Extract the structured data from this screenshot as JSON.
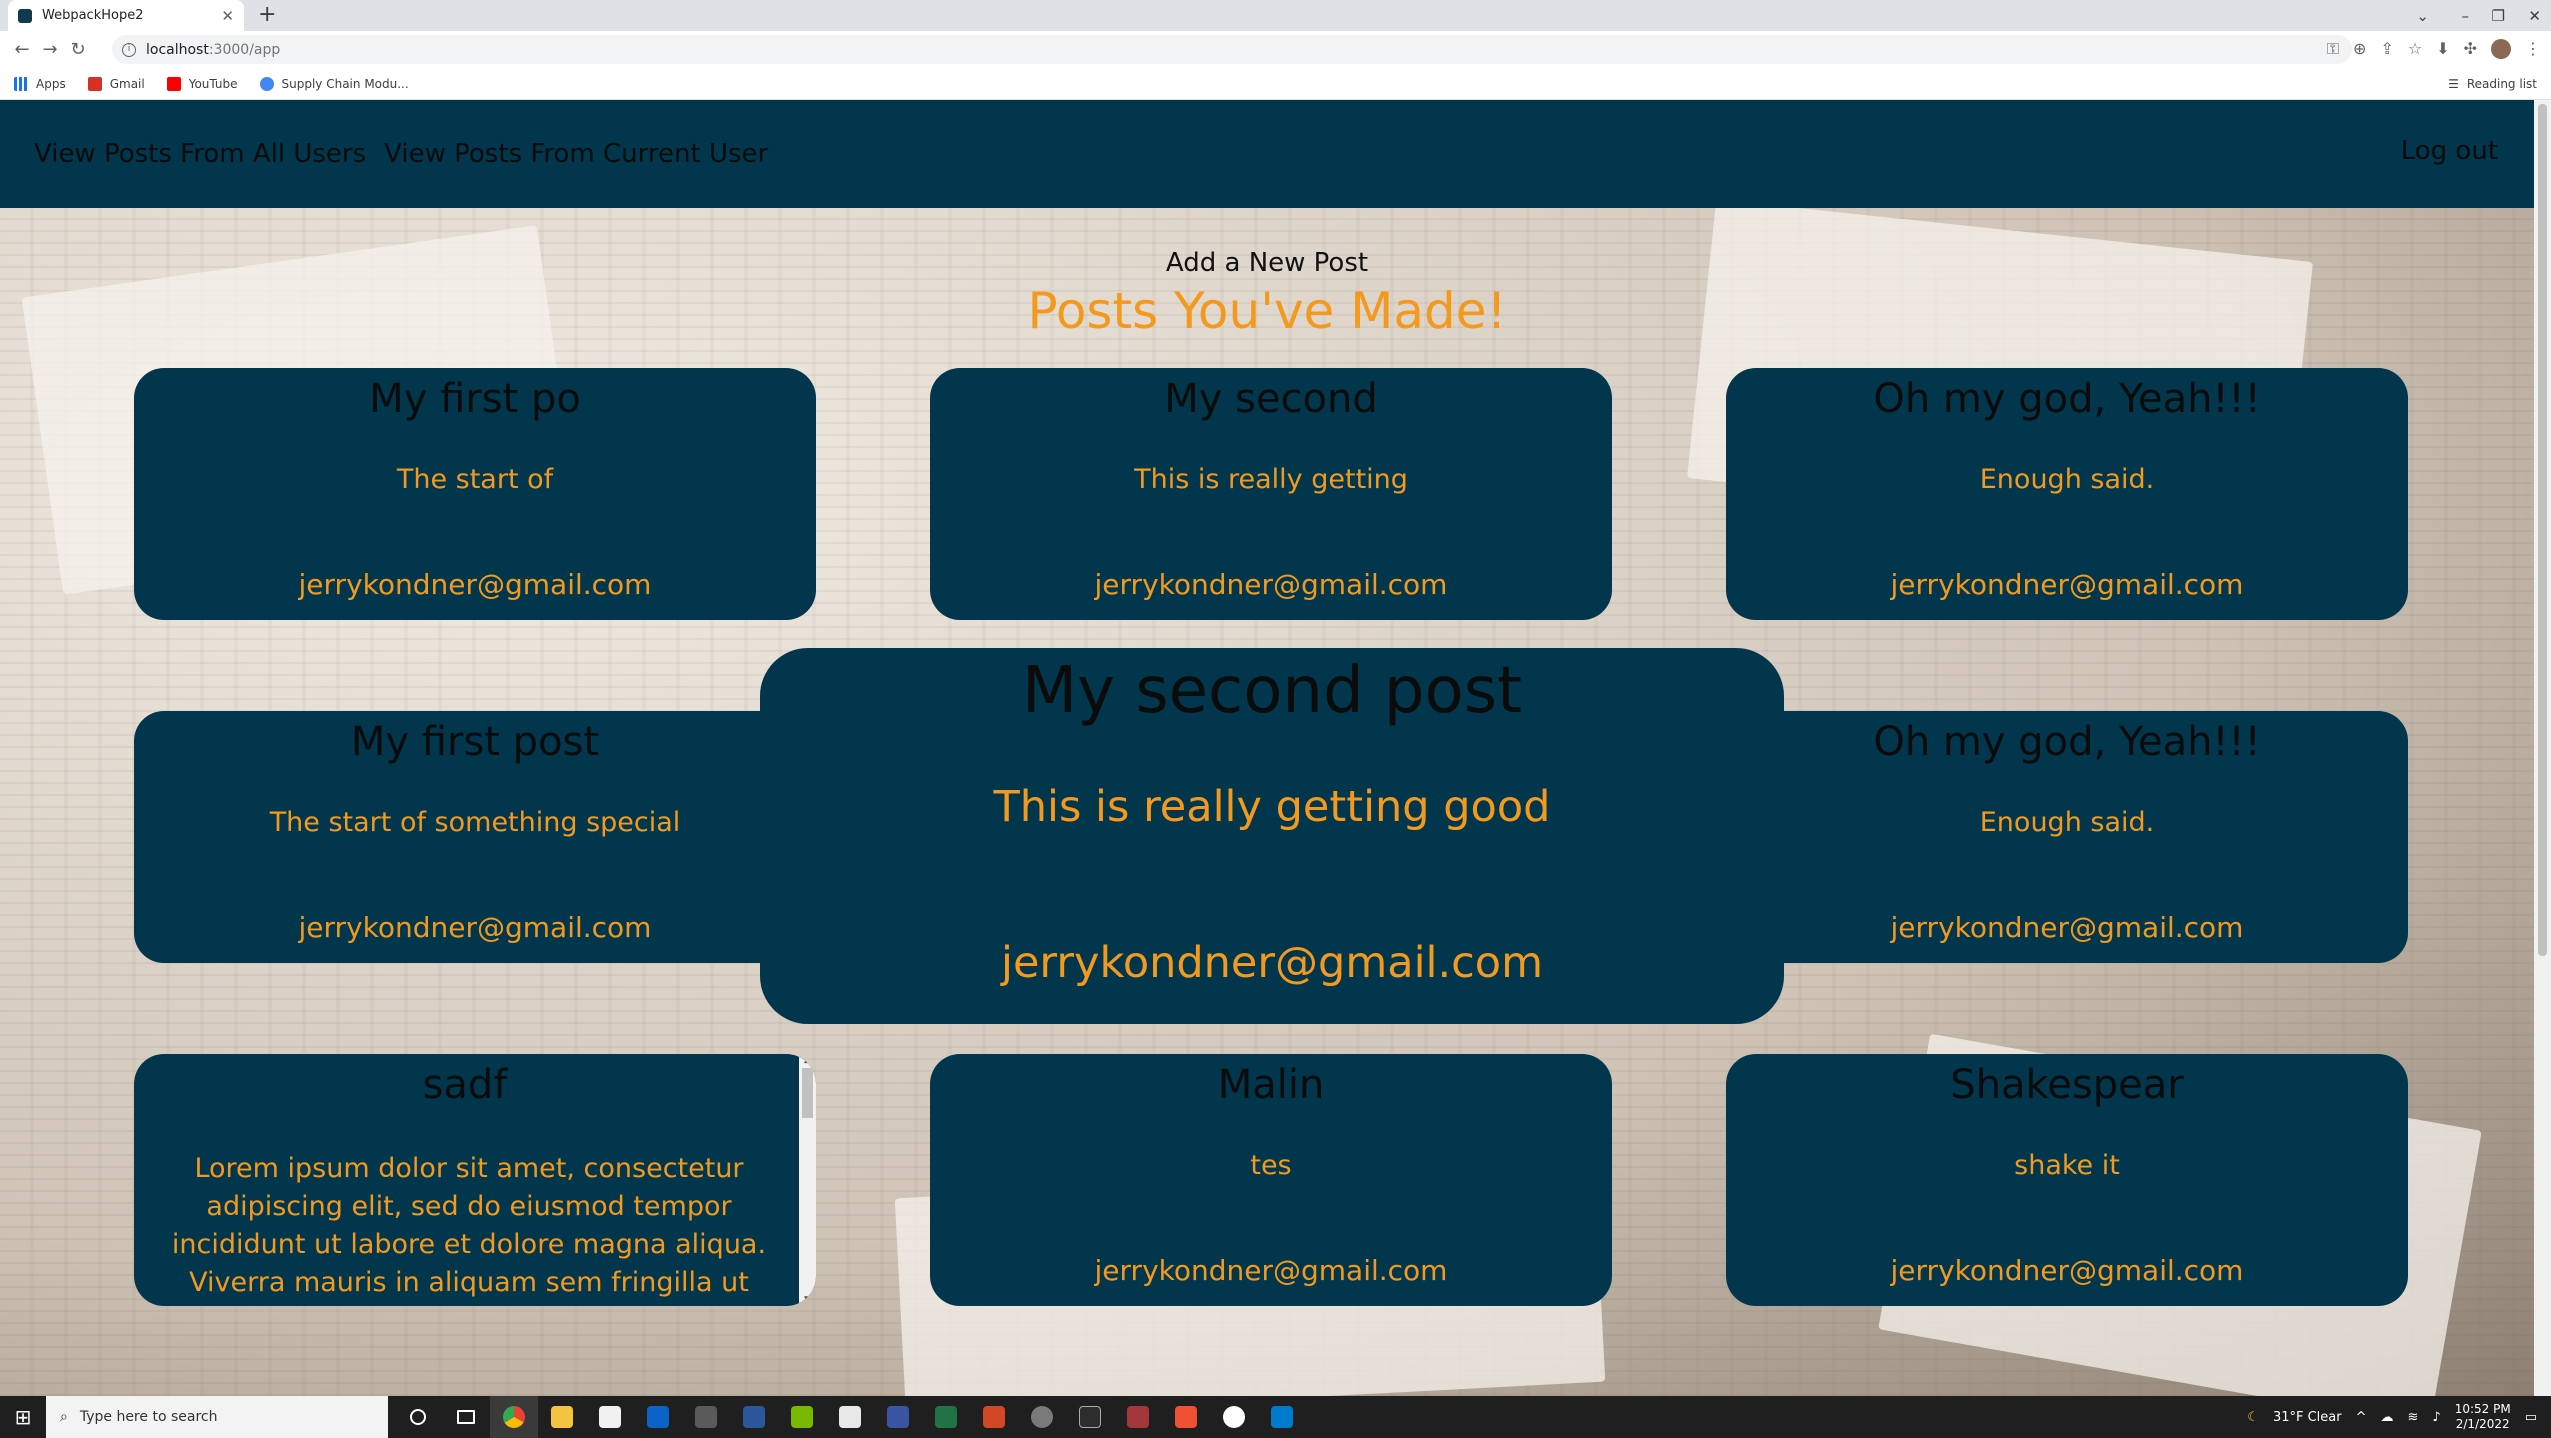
{
  "browser": {
    "tab_title": "WebpackHope2",
    "new_tab": "+",
    "url_host": "localhost",
    "url_path": ":3000/app",
    "bookmarks": [
      {
        "label": "Apps",
        "color": "#1a73e8"
      },
      {
        "label": "Gmail",
        "color": "#d93025"
      },
      {
        "label": "YouTube",
        "color": "#ff0000"
      },
      {
        "label": "Supply Chain Modu...",
        "color": "#4285f4"
      }
    ],
    "reading_list": "Reading list"
  },
  "nav": {
    "all_posts": "View Posts From All Users",
    "current_user_posts": "View Posts From Current User",
    "logout": "Log out"
  },
  "page": {
    "add_post": "Add a New Post",
    "heading": "Posts You've Made!"
  },
  "posts": [
    {
      "title": "My first po",
      "body": "The start of",
      "user": "jerrykondner@gmail.com"
    },
    {
      "title": "My second",
      "body": "This is really getting",
      "user": "jerrykondner@gmail.com"
    },
    {
      "title": "Oh my god, Yeah!!!",
      "body": "Enough said.",
      "user": "jerrykondner@gmail.com"
    },
    {
      "title": "My first post",
      "body": "The start of something special",
      "user": "jerrykondner@gmail.com"
    },
    {
      "title": "Oh my god, Yeah!!!",
      "body": "Enough said.",
      "user": "jerrykondner@gmail.com"
    },
    {
      "title": "sadf",
      "body": "Lorem ipsum dolor sit amet, consectetur adipiscing elit, sed do eiusmod tempor incididunt ut labore et dolore magna aliqua. Viverra mauris in aliquam sem fringilla ut morbi. Libero justo laoreet sit amet cursus sit amet dictum sit. Sed lectus vestibulum mattis",
      "user": "jerrykondner@gmail.com"
    },
    {
      "title": "Malin",
      "body": "tes",
      "user": "jerrykondner@gmail.com"
    },
    {
      "title": "Shakespear",
      "body": "shake it",
      "user": "jerrykondner@gmail.com"
    }
  ],
  "modal": {
    "title": "My second post",
    "body": "This is really getting good",
    "user": "jerrykondner@gmail.com"
  },
  "taskbar": {
    "search_placeholder": "Type here to search",
    "weather": "31°F  Clear",
    "time": "10:52 PM",
    "date": "2/1/2022"
  },
  "colors": {
    "navbar": "#02364c",
    "card": "#02364c",
    "accent": "#f39a1e"
  }
}
